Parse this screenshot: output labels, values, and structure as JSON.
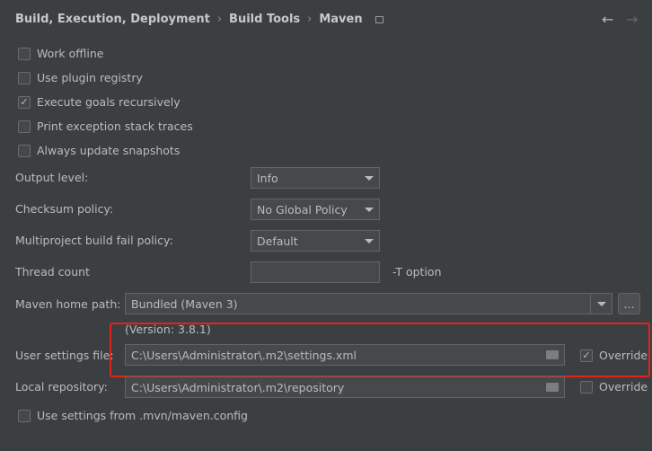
{
  "breadcrumb": {
    "items": [
      "Build, Execution, Deployment",
      "Build Tools",
      "Maven"
    ],
    "separator": "›"
  },
  "nav": {
    "back": "←",
    "forward": "→"
  },
  "checkboxes": [
    {
      "label": "Work offline",
      "checked": false
    },
    {
      "label": "Use plugin registry",
      "checked": false
    },
    {
      "label": "Execute goals recursively",
      "checked": true
    },
    {
      "label": "Print exception stack traces",
      "checked": false
    },
    {
      "label": "Always update snapshots",
      "checked": false
    }
  ],
  "output_level": {
    "label": "Output level:",
    "value": "Info"
  },
  "checksum_policy": {
    "label": "Checksum policy:",
    "value": "No Global Policy"
  },
  "multiproject": {
    "label": "Multiproject build fail policy:",
    "value": "Default"
  },
  "thread_count": {
    "label": "Thread count",
    "value": "",
    "hint": "-T option"
  },
  "maven_home": {
    "label": "Maven home path:",
    "value": "Bundled (Maven 3)",
    "browse": "...",
    "version": "(Version: 3.8.1)"
  },
  "user_settings": {
    "label": "User settings file:",
    "value": "C:\\Users\\Administrator\\.m2\\settings.xml",
    "override_label": "Override",
    "override": true
  },
  "local_repo": {
    "label": "Local repository:",
    "value": "C:\\Users\\Administrator\\.m2\\repository",
    "override_label": "Override",
    "override": false
  },
  "mvn_config": {
    "label": "Use settings from .mvn/maven.config",
    "checked": false
  },
  "highlight_color": "#e0241b",
  "check_mark": "✓"
}
